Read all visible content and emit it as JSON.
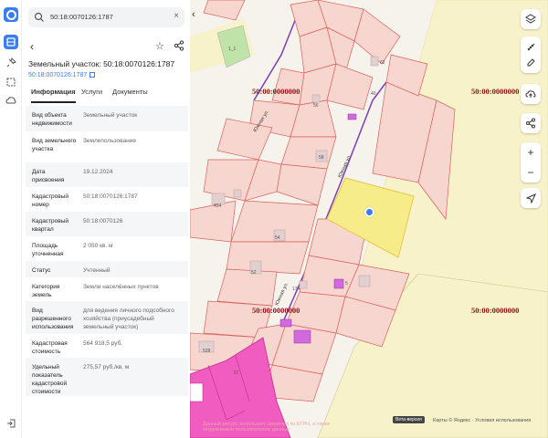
{
  "search": {
    "value": "50:18:0070126:1787"
  },
  "header": {
    "title": "Земельный участок: 50:18:0070126:1787",
    "sub_link": "50:18:0070126:1787"
  },
  "tabs": [
    {
      "label": "Информация"
    },
    {
      "label": "Услуги"
    },
    {
      "label": "Документы"
    }
  ],
  "info_rows": [
    {
      "key": "Вид объекта недвижимости",
      "value": "Земельный участок"
    },
    {
      "key": "Вид земельного участка",
      "value": "Землепользование"
    },
    {
      "key": "Дата присвоения",
      "value": "19.12.2024"
    },
    {
      "key": "Кадастровый номер",
      "value": "50:18:0070126:1787"
    },
    {
      "key": "Кадастровый квартал",
      "value": "50:18:0070126"
    },
    {
      "key": "Площадь уточненная",
      "value": "2 050 кв. м"
    },
    {
      "key": "Статус",
      "value": "Учтенный"
    },
    {
      "key": "Категория земель",
      "value": "Земли населённых пунктов"
    },
    {
      "key": "Вид разрешенного использования",
      "value": "для ведения личного подсобного хозяйства (приусадебный земельный участок)"
    },
    {
      "key": "Кадастровая стоимость",
      "value": "564 918,5 руб."
    },
    {
      "key": "Удельный показатель кадастровой стоимости",
      "value": "275,57 руб./кв. м"
    }
  ],
  "map": {
    "district_labels": [
      "50:00:0000000",
      "50:00:0000000",
      "50:00:0000000",
      "50:00:0000000"
    ],
    "street_labels": [
      "Южная ул.",
      "Южная ул.",
      "Южная ул."
    ],
    "parcel_numbers": [
      "1_1",
      "62",
      "40",
      "56",
      "58",
      "434",
      "54",
      "52",
      "57",
      "174",
      "528",
      "5"
    ],
    "attribution_dark": "Вета-версия",
    "attribution": "Карты © Яндекс · Условия использования",
    "footer_note": "Данный ресурс использует сведения из ЕГРН, а также загружаемые пользователем данные"
  },
  "colors": {
    "accent": "#3a7df0",
    "parcel_fill": "#f7d6d0",
    "parcel_stroke": "#d9605a",
    "selected_fill": "#f7ec8a",
    "magenta_fill": "#f05cc0",
    "district_label": "#8b1010",
    "yellow_zone": "#f7f2c9",
    "road": "#7b3fb0"
  },
  "icons": {
    "search": "search-icon",
    "close": "close-icon",
    "back": "chevron-left-icon",
    "star": "star-icon",
    "share": "share-icon",
    "layers": "layers-icon",
    "ruler": "ruler-icon",
    "edit": "edit-icon",
    "upload": "upload-icon",
    "network": "share-network-icon",
    "zoom_in": "plus-icon",
    "zoom_out": "minus-icon",
    "locate": "locate-arrow-icon"
  }
}
